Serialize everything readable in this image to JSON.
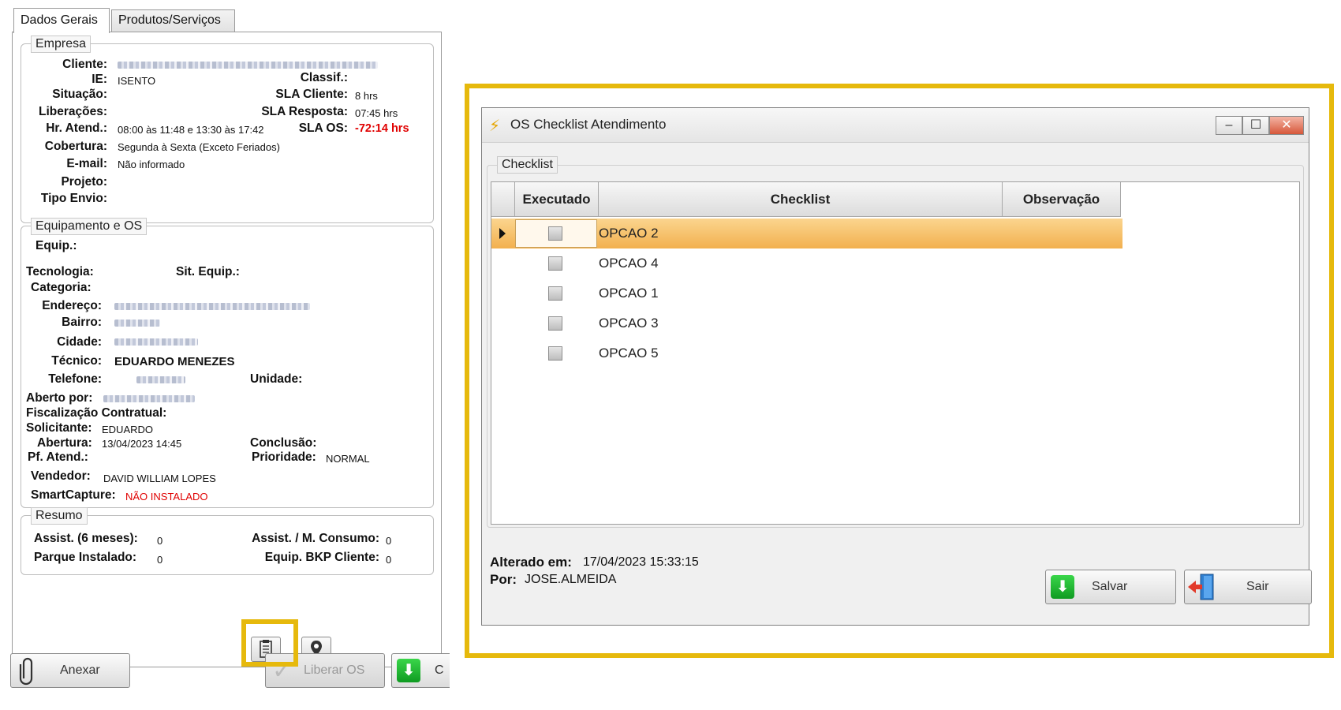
{
  "tabs": [
    {
      "label": "Dados Gerais",
      "active": true
    },
    {
      "label": "Produtos/Serviços",
      "active": false
    }
  ],
  "empresa": {
    "title": "Empresa",
    "cliente_label": "Cliente:",
    "ie_label": "IE:",
    "ie_value": "ISENTO",
    "classif_label": "Classif.:",
    "situacao_label": "Situação:",
    "sla_cliente_label": "SLA Cliente:",
    "sla_cliente_value": "8 hrs",
    "liberacoes_label": "Liberações:",
    "sla_resposta_label": "SLA Resposta:",
    "sla_resposta_value": "07:45 hrs",
    "hr_atend_label": "Hr. Atend.:",
    "hr_atend_value": "08:00 às 11:48 e 13:30 às 17:42",
    "sla_os_label": "SLA OS:",
    "sla_os_value": "-72:14 hrs",
    "cobertura_label": "Cobertura:",
    "cobertura_value": "Segunda à Sexta (Exceto Feriados)",
    "email_label": "E-mail:",
    "email_value": "Não informado",
    "projeto_label": "Projeto:",
    "tipo_envio_label": "Tipo Envio:"
  },
  "equipamento": {
    "title": "Equipamento e OS",
    "equip_label": "Equip.:",
    "tecnologia_label": "Tecnologia:",
    "sit_equip_label": "Sit. Equip.:",
    "categoria_label": "Categoria:",
    "endereco_label": "Endereço:",
    "bairro_label": "Bairro:",
    "cidade_label": "Cidade:",
    "tecnico_label": "Técnico:",
    "tecnico_value": "EDUARDO MENEZES",
    "telefone_label": "Telefone:",
    "unidade_label": "Unidade:",
    "aberto_por_label": "Aberto por:",
    "fiscalizacao_label": "Fiscalização Contratual:",
    "solicitante_label": "Solicitante:",
    "solicitante_value": "EDUARDO",
    "abertura_label": "Abertura:",
    "abertura_value": "13/04/2023 14:45",
    "conclusao_label": "Conclusão:",
    "pf_atend_label": "Pf. Atend.:",
    "prioridade_label": "Prioridade:",
    "prioridade_value": "NORMAL",
    "vendedor_label": "Vendedor:",
    "vendedor_value": "DAVID WILLIAM LOPES",
    "smartcapture_label": "SmartCapture:",
    "smartcapture_value": "NÃO INSTALADO"
  },
  "resumo": {
    "title": "Resumo",
    "assist_label": "Assist. (6 meses):",
    "assist_value": "0",
    "assist_consumo_label": "Assist. / M. Consumo:",
    "assist_consumo_value": "0",
    "parque_label": "Parque Instalado:",
    "parque_value": "0",
    "bkp_label": "Equip. BKP Cliente:",
    "bkp_value": "0"
  },
  "bottom_buttons": {
    "anexar": "Anexar",
    "liberar_os": "Liberar OS",
    "truncated": "C"
  },
  "dialog": {
    "title": "OS Checklist Atendimento",
    "group_title": "Checklist",
    "columns": [
      "Executado",
      "Checklist",
      "Observação"
    ],
    "rows": [
      {
        "label": "OPCAO 2",
        "checked": false
      },
      {
        "label": "OPCAO 4",
        "checked": false
      },
      {
        "label": "OPCAO 1",
        "checked": false
      },
      {
        "label": "OPCAO 3",
        "checked": false
      },
      {
        "label": "OPCAO 5",
        "checked": false
      }
    ],
    "alterado_label": "Alterado em:",
    "alterado_value": "17/04/2023 15:33:15",
    "por_label": "Por:",
    "por_value": "JOSE.ALMEIDA",
    "salvar": "Salvar",
    "sair": "Sair",
    "win_minimize": "–",
    "win_maximize": "☐",
    "win_close": "✕"
  },
  "colors": {
    "highlight": "#e6b90c",
    "selected_row": "#f2b04e",
    "alert_red": "#e00000"
  }
}
